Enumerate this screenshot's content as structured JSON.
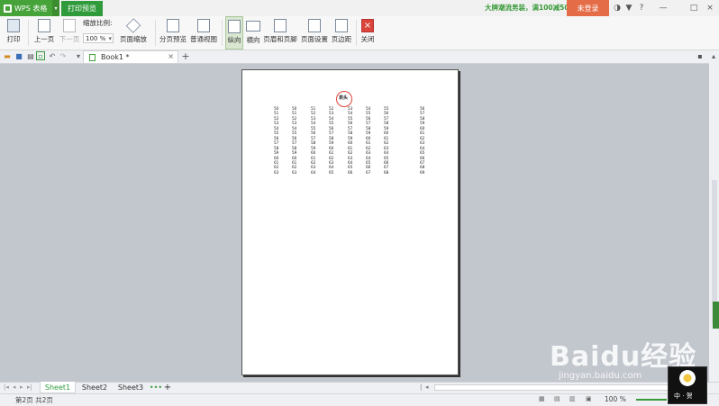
{
  "titlebar": {
    "app_name": "WPS 表格",
    "active_tab": "打印预览",
    "promo": "大牌潮流男装，满100减50",
    "login": "未登录",
    "controls": [
      "?",
      "—",
      "□",
      "×"
    ]
  },
  "ribbon": {
    "print": "打印",
    "prev_page": "上一页",
    "next_page": "下一页",
    "zoom_label": "缩放比例:",
    "zoom_value": "100 %",
    "page_zoom": "页面缩放",
    "page_break_preview": "分页预览",
    "normal_view": "普通视图",
    "portrait": "纵向",
    "landscape": "横向",
    "header_footer": "页眉和页脚",
    "page_setup": "页面设置",
    "margins": "页边距",
    "close": "关闭"
  },
  "tabbar": {
    "doc_name": "Book1 *",
    "add": "+"
  },
  "page": {
    "title": "表头",
    "columns": [
      [
        "50",
        "51",
        "52",
        "53",
        "54",
        "55",
        "56",
        "57",
        "58",
        "59",
        "60",
        "61",
        "62",
        "63"
      ],
      [
        "50",
        "51",
        "52",
        "53",
        "54",
        "55",
        "56",
        "57",
        "58",
        "59",
        "60",
        "61",
        "62",
        "63"
      ],
      [
        "51",
        "52",
        "53",
        "54",
        "55",
        "56",
        "57",
        "58",
        "59",
        "60",
        "61",
        "62",
        "63",
        "64"
      ],
      [
        "52",
        "53",
        "54",
        "55",
        "56",
        "57",
        "58",
        "59",
        "60",
        "61",
        "62",
        "63",
        "64",
        "65"
      ],
      [
        "53",
        "54",
        "55",
        "56",
        "57",
        "58",
        "59",
        "60",
        "61",
        "62",
        "63",
        "64",
        "65",
        "66"
      ],
      [
        "54",
        "55",
        "56",
        "57",
        "58",
        "59",
        "60",
        "61",
        "62",
        "63",
        "64",
        "65",
        "66",
        "67"
      ],
      [
        "55",
        "56",
        "57",
        "58",
        "59",
        "60",
        "61",
        "62",
        "63",
        "64",
        "65",
        "66",
        "67",
        "68"
      ],
      [
        "56",
        "57",
        "58",
        "59",
        "60",
        "61",
        "62",
        "63",
        "64",
        "65",
        "66",
        "67",
        "68",
        "69"
      ]
    ]
  },
  "sheets": [
    "Sheet1",
    "Sheet2",
    "Sheet3"
  ],
  "sheet_more": "•••",
  "sheet_add": "+",
  "status": {
    "page_info": "第2页 共2页",
    "zoom": "100 %"
  },
  "watermark": {
    "brand": "Baidu经验",
    "url": "jingyan.baidu.com",
    "avatar_text": "中 · 贺"
  },
  "colors": {
    "accent": "#46a33a",
    "login": "#e46c47",
    "circle": "#e2443a"
  }
}
